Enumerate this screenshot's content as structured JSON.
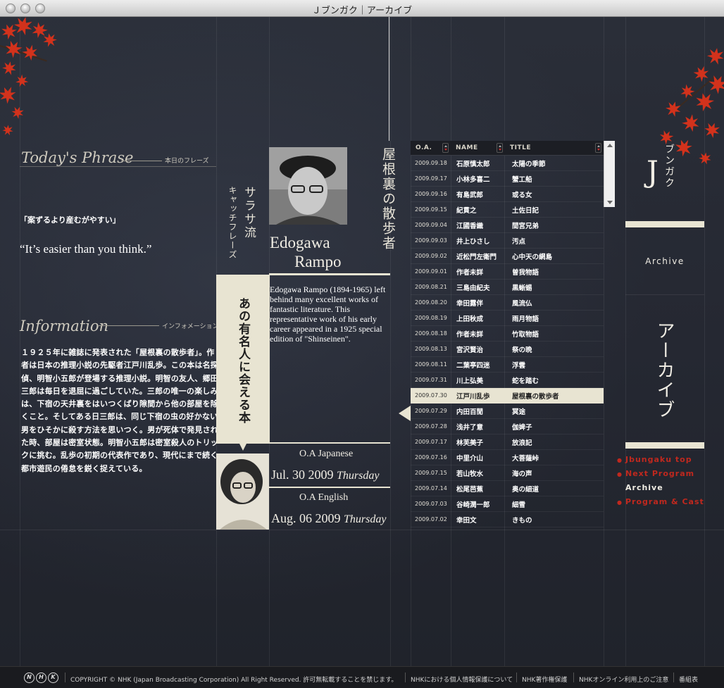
{
  "window": {
    "title": "Ｊブンガク｜アーカイブ"
  },
  "phrase": {
    "heading": "Today's Phrase",
    "heading_jp": "本日のフレーズ",
    "jp": "「案ずるより産むがやすい」",
    "en": "“It’s easier than you think.”"
  },
  "information": {
    "heading": "Information",
    "heading_jp": "インフォメーション",
    "body": "１９２５年に雑誌に発表された「屋根裏の散歩者」。作者は日本の推理小説の先駆者江戸川乱歩。この本は名探偵、明智小五郎が登場する推理小説。明智の友人、郷田三郎は毎日を退屈に過ごしていた。三郎の唯一の楽しみは、下宿の天井裏をはいつくばり隙間から他の部屋を除くこと。そしてある日三郎は、同じ下宿の虫の好かない男をひそかに殺す方法を思いつく。男が死体で発見された時、部屋は密室状態。明智小五郎は密室殺人のトリックに挑む。乱歩の初期の代表作であり、現代にまで続く都市遊民の倦怠を鋭く捉えている。"
  },
  "feature": {
    "catch_title": "サラサ流",
    "catch_sub": "キャッチフレーズ",
    "banner": "あの有名人に会える本",
    "book_title": "屋根裏の散歩者",
    "author_first": "Edogawa",
    "author_last": "Rampo",
    "bio": "Edogawa Rampo (1894-1965) left behind many excellent works of fantastic literature. This representative work of his early career appeared in a 1925 special edition of \"Shinseinen\".",
    "oa_japanese_label": "O.A Japanese",
    "oa_japanese_date": "Jul. 30 2009",
    "oa_japanese_day": "Thursday",
    "oa_english_label": "O.A English",
    "oa_english_date": "Aug. 06 2009",
    "oa_english_day": "Thursday"
  },
  "archive_table": {
    "columns": [
      "O.A.",
      "NAME",
      "TITLE"
    ],
    "selected_index": 15,
    "rows": [
      [
        "2009.09.18",
        "石原慎太郎",
        "太陽の季節"
      ],
      [
        "2009.09.17",
        "小林多喜二",
        "蟹工船"
      ],
      [
        "2009.09.16",
        "有島武郎",
        "或る女"
      ],
      [
        "2009.09.15",
        "紀貫之",
        "土佐日記"
      ],
      [
        "2009.09.04",
        "江國香織",
        "間宮兄弟"
      ],
      [
        "2009.09.03",
        "井上ひさし",
        "汚点"
      ],
      [
        "2009.09.02",
        "近松門左衛門",
        "心中天の網島"
      ],
      [
        "2009.09.01",
        "作者未詳",
        "曽我物語"
      ],
      [
        "2009.08.21",
        "三島由紀夫",
        "黒蜥蜴"
      ],
      [
        "2009.08.20",
        "幸田露伴",
        "風流仏"
      ],
      [
        "2009.08.19",
        "上田秋成",
        "雨月物語"
      ],
      [
        "2009.08.18",
        "作者未詳",
        "竹取物語"
      ],
      [
        "2009.08.13",
        "宮沢賢治",
        "祭の晩"
      ],
      [
        "2009.08.11",
        "二葉亭四迷",
        "浮雲"
      ],
      [
        "2009.07.31",
        "川上弘美",
        "蛇を踏む"
      ],
      [
        "2009.07.30",
        "江戸川乱歩",
        "屋根裏の散歩者"
      ],
      [
        "2009.07.29",
        "内田百閒",
        "冥途"
      ],
      [
        "2009.07.28",
        "浅井了意",
        "伽婢子"
      ],
      [
        "2009.07.17",
        "林芙美子",
        "放浪記"
      ],
      [
        "2009.07.16",
        "中里介山",
        "大菩薩峠"
      ],
      [
        "2009.07.15",
        "若山牧水",
        "海の声"
      ],
      [
        "2009.07.14",
        "松尾芭蕉",
        "奥の細道"
      ],
      [
        "2009.07.03",
        "谷崎潤一郎",
        "細雪"
      ],
      [
        "2009.07.02",
        "幸田文",
        "きもの"
      ]
    ]
  },
  "sidebar": {
    "logo_j": "J",
    "logo_text": "ブンガク",
    "archive_en": "Archive",
    "archive_jp": "アーカイブ",
    "nav": [
      {
        "label": "Jbungaku top",
        "current": false
      },
      {
        "label": "Next Program",
        "current": false
      },
      {
        "label": "Archive",
        "current": true
      },
      {
        "label": "Program & Cast",
        "current": false
      }
    ]
  },
  "footer": {
    "logo": [
      "N",
      "H",
      "K"
    ],
    "copyright": "COPYRIGHT © NHK (Japan Broadcasting Corporation) All Right Reserved.  許可無転載することを禁じます。",
    "links": [
      "NHKにおける個人情報保護について",
      "NHK著作権保護",
      "NHKオンライン利用上のご注意",
      "番組表"
    ]
  },
  "colors": {
    "background": "#23262f",
    "cream": "#e8e4d2",
    "accent_red": "#c0281e"
  }
}
